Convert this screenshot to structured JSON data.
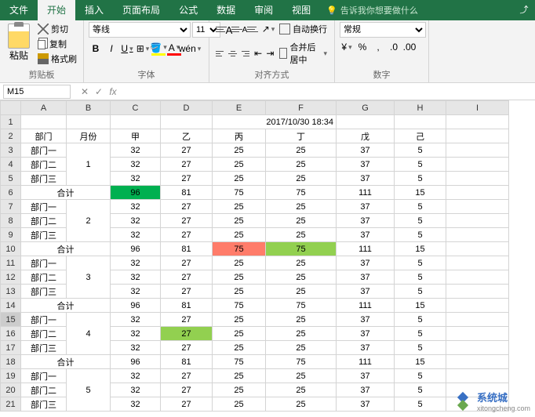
{
  "tabs": {
    "file": "文件",
    "home": "开始",
    "insert": "插入",
    "layout": "页面布局",
    "formula": "公式",
    "data": "数据",
    "review": "审阅",
    "view": "视图"
  },
  "tell_me": "告诉我你想要做什么",
  "clipboard": {
    "paste": "粘贴",
    "cut": "剪切",
    "copy": "复制",
    "brush": "格式刷",
    "label": "剪贴板"
  },
  "font": {
    "name": "等线",
    "size": "11",
    "label": "字体"
  },
  "align": {
    "wrap": "自动换行",
    "merge": "合并后居中",
    "label": "对齐方式"
  },
  "number": {
    "format": "常规",
    "label": "数字"
  },
  "namebox": "M15",
  "headers": {
    "date": "2017/10/30 18:34",
    "dept": "部门",
    "month": "月份",
    "c1": "甲",
    "c2": "乙",
    "c3": "丙",
    "c4": "丁",
    "c5": "戊",
    "c6": "己"
  },
  "dept": {
    "d1": "部门一",
    "d2": "部门二",
    "d3": "部门三",
    "total": "合计"
  },
  "months": {
    "m1": "1",
    "m2": "2",
    "m3": "3",
    "m4": "4",
    "m5": "5"
  },
  "rows": [
    {
      "a": "部门一",
      "b": "",
      "c": "32",
      "d": "27",
      "e": "25",
      "f": "25",
      "g": "37",
      "h": "5"
    },
    {
      "a": "部门二",
      "b": "1",
      "c": "32",
      "d": "27",
      "e": "25",
      "f": "25",
      "g": "37",
      "h": "5"
    },
    {
      "a": "部门三",
      "b": "",
      "c": "32",
      "d": "27",
      "e": "25",
      "f": "25",
      "g": "37",
      "h": "5"
    },
    {
      "a": "合计",
      "b": "",
      "c": "96",
      "d": "81",
      "e": "75",
      "f": "75",
      "g": "111",
      "h": "15"
    },
    {
      "a": "部门一",
      "b": "",
      "c": "32",
      "d": "27",
      "e": "25",
      "f": "25",
      "g": "37",
      "h": "5"
    },
    {
      "a": "部门二",
      "b": "2",
      "c": "32",
      "d": "27",
      "e": "25",
      "f": "25",
      "g": "37",
      "h": "5"
    },
    {
      "a": "部门三",
      "b": "",
      "c": "32",
      "d": "27",
      "e": "25",
      "f": "25",
      "g": "37",
      "h": "5"
    },
    {
      "a": "合计",
      "b": "",
      "c": "96",
      "d": "81",
      "e": "75",
      "f": "75",
      "g": "111",
      "h": "15"
    },
    {
      "a": "部门一",
      "b": "",
      "c": "32",
      "d": "27",
      "e": "25",
      "f": "25",
      "g": "37",
      "h": "5"
    },
    {
      "a": "部门二",
      "b": "3",
      "c": "32",
      "d": "27",
      "e": "25",
      "f": "25",
      "g": "37",
      "h": "5"
    },
    {
      "a": "部门三",
      "b": "",
      "c": "32",
      "d": "27",
      "e": "25",
      "f": "25",
      "g": "37",
      "h": "5"
    },
    {
      "a": "合计",
      "b": "",
      "c": "96",
      "d": "81",
      "e": "75",
      "f": "75",
      "g": "111",
      "h": "15"
    },
    {
      "a": "部门一",
      "b": "",
      "c": "32",
      "d": "27",
      "e": "25",
      "f": "25",
      "g": "37",
      "h": "5"
    },
    {
      "a": "部门二",
      "b": "4",
      "c": "32",
      "d": "27",
      "e": "25",
      "f": "25",
      "g": "37",
      "h": "5"
    },
    {
      "a": "部门三",
      "b": "",
      "c": "32",
      "d": "27",
      "e": "25",
      "f": "25",
      "g": "37",
      "h": "5"
    },
    {
      "a": "合计",
      "b": "",
      "c": "96",
      "d": "81",
      "e": "75",
      "f": "75",
      "g": "111",
      "h": "15"
    },
    {
      "a": "部门一",
      "b": "",
      "c": "32",
      "d": "27",
      "e": "25",
      "f": "25",
      "g": "37",
      "h": "5"
    },
    {
      "a": "部门二",
      "b": "5",
      "c": "32",
      "d": "27",
      "e": "25",
      "f": "25",
      "g": "37",
      "h": "5"
    },
    {
      "a": "部门三",
      "b": "",
      "c": "32",
      "d": "27",
      "e": "25",
      "f": "25",
      "g": "37",
      "h": "5"
    }
  ],
  "watermark": {
    "title": "系统城",
    "url": "xitongcheng.com"
  }
}
